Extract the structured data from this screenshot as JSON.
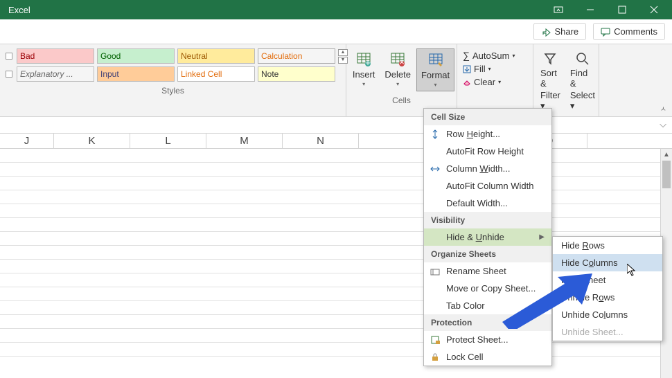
{
  "title": "Excel",
  "share": "Share",
  "comments": "Comments",
  "styles": {
    "row1": [
      "Bad",
      "Good",
      "Neutral",
      "Calculation"
    ],
    "row2": [
      "Explanatory ...",
      "Input",
      "Linked Cell",
      "Note"
    ],
    "label": "Styles"
  },
  "cells": {
    "insert": "Insert",
    "delete": "Delete",
    "format": "Format",
    "label": "Cells"
  },
  "editing": {
    "autosum": "AutoSum",
    "fill": "Fill",
    "clear": "Clear"
  },
  "sortfilter": {
    "sort": "Sort &",
    "filter": "Filter"
  },
  "findselect": {
    "find": "Find &",
    "select": "Select"
  },
  "columns": [
    "J",
    "K",
    "L",
    "M",
    "N",
    "",
    "",
    "Q"
  ],
  "menu1": {
    "s1": "Cell Size",
    "row_height": "Row Height...",
    "autofit_row": "AutoFit Row Height",
    "col_width": "Column Width...",
    "autofit_col": "AutoFit Column Width",
    "default_width": "Default Width...",
    "s2": "Visibility",
    "hide_unhide": "Hide & Unhide",
    "s3": "Organize Sheets",
    "rename": "Rename Sheet",
    "move_copy": "Move or Copy Sheet...",
    "tab_color": "Tab Color",
    "s4": "Protection",
    "protect": "Protect Sheet...",
    "lock": "Lock Cell"
  },
  "menu2": {
    "hide_rows": "Hide Rows",
    "hide_cols": "Hide Columns",
    "hide_sheet": "Hide Sheet",
    "unhide_rows": "Unhide Rows",
    "unhide_cols": "Unhide Columns",
    "unhide_sheet": "Unhide Sheet..."
  }
}
